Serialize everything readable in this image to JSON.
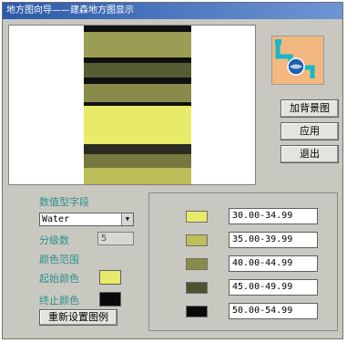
{
  "window": {
    "title": "地方图向导——建森地方图显示"
  },
  "preview": {
    "stripes": [
      {
        "color": "#111111",
        "flex": 5
      },
      {
        "color": "#9c9d55",
        "flex": 20
      },
      {
        "color": "#111111",
        "flex": 5
      },
      {
        "color": "#585c33",
        "flex": 11
      },
      {
        "color": "#111111",
        "flex": 5
      },
      {
        "color": "#8a8b4a",
        "flex": 15
      },
      {
        "color": "#111111",
        "flex": 3
      },
      {
        "color": "#e8ea6a",
        "flex": 30
      },
      {
        "color": "#2c2c22",
        "flex": 8
      },
      {
        "color": "#77783f",
        "flex": 11
      },
      {
        "color": "#bdbd5a",
        "flex": 13
      }
    ]
  },
  "side_image": {
    "icon": "globe-pipe-icon",
    "accent": "#17b8c8"
  },
  "buttons": {
    "background": "加背景图",
    "apply": "应用",
    "exit": "退出"
  },
  "fields": {
    "value_field_label": "数值型字段",
    "value_field_selected": "Water",
    "class_count_label": "分级数",
    "class_count_value": "5",
    "color_range_label": "颜色范围",
    "start_color_label": "起始颜色",
    "start_color": "#e8ea6a",
    "end_color_label": "终止颜色",
    "end_color": "#0a0a0a",
    "reset_button": "重新设置图例"
  },
  "legend": [
    {
      "color": "#e8ea6a",
      "range": "30.00-34.99"
    },
    {
      "color": "#bdbd5a",
      "range": "35.00-39.99"
    },
    {
      "color": "#8a8b4a",
      "range": "40.00-44.99"
    },
    {
      "color": "#4e5230",
      "range": "45.00-49.99"
    },
    {
      "color": "#0a0a0a",
      "range": "50.00-54.99"
    }
  ]
}
